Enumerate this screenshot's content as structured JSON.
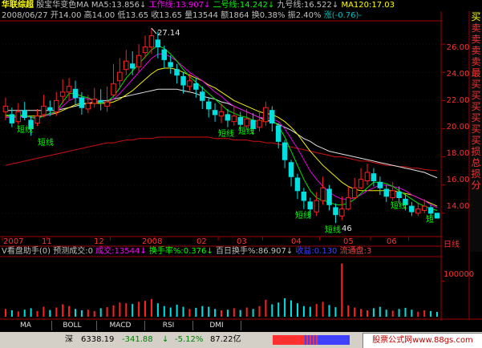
{
  "header": {
    "stock_name": "华联综超",
    "indicator_name": "殷宝华变色MA",
    "ma5": "MA5:13.856",
    "ma5_arrow": "↓",
    "work_line": "工作线:13.907",
    "work_arrow": "↓",
    "line2": "二号线:14.242",
    "line2_arrow": "↓",
    "line9": "九号线:16.522",
    "line9_arrow": "↓",
    "ma120": "MA120:17.03",
    "date": "2008/06/27",
    "open": "开14.00",
    "high": "高14.00",
    "low": "低13.65",
    "close": "收13.65",
    "volume": "量13544",
    "amount": "额1864",
    "turnover": "换0.38%",
    "amplitude": "振2.40%",
    "change": "涨(-0.76)-"
  },
  "indicator_header": {
    "title": "V看盘助手(0)",
    "predict": "预测成交:0",
    "volume": "成交:13544",
    "vol_arrow": "↓",
    "turnover_rate": "换手率%:0.376",
    "turnover_arrow": "↓",
    "hundred_day": "百日换手%:86.907",
    "hundred_arrow": "↓",
    "profit": "收益:0.130",
    "float_shares": "流通盘:3"
  },
  "side_panel": {
    "chars": [
      "买",
      "卖",
      "卖",
      "卖",
      "卖",
      "最",
      "买",
      "买",
      "买",
      "买",
      "买",
      "买",
      "损",
      "总",
      "损",
      "分"
    ]
  },
  "tabs": [
    "MA",
    "BOLL",
    "MACD",
    "RSI",
    "DMI"
  ],
  "status_bar": {
    "market": "深",
    "index": "6338.19",
    "change": "-341.88",
    "down": "↓",
    "percent": "-5.12%",
    "amount": "87.22亿",
    "watermark": "股票公式网www.88gs.com"
  },
  "annotations": {
    "peak_label": "27.14",
    "low_label": "46",
    "short_labels": [
      "短线",
      "短线",
      "短线",
      "短线",
      "短线",
      "短线",
      "短线",
      "短线",
      "短"
    ],
    "period_label": "日线"
  },
  "chart_data": [
    {
      "type": "line",
      "title": "殷宝华变色MA",
      "series_names": [
        "MA5",
        "工作线",
        "二号线",
        "九号线",
        "MA120"
      ],
      "ylim": [
        12.4,
        27.6
      ],
      "y_ticks": [
        14.0,
        16.0,
        18.0,
        20.0,
        22.0,
        24.0,
        26.0
      ],
      "x_ticks": [
        "2007",
        "11",
        "12",
        "2008",
        "02",
        "03",
        "04",
        "05",
        "06"
      ],
      "annotated_peak": 27.14,
      "candles": [
        [
          21.2,
          21.6,
          22.2,
          20.6
        ],
        [
          21.0,
          20.4,
          21.5,
          20.1
        ],
        [
          20.5,
          21.2,
          21.8,
          20.3
        ],
        [
          21.3,
          20.8,
          21.9,
          20.6
        ],
        [
          20.6,
          20.0,
          20.9,
          19.5
        ],
        [
          20.4,
          20.9,
          21.4,
          20.2
        ],
        [
          21.0,
          21.6,
          22.4,
          20.8
        ],
        [
          21.5,
          21.3,
          22.0,
          20.9
        ],
        [
          21.2,
          22.0,
          22.6,
          20.9
        ],
        [
          22.3,
          22.6,
          23.5,
          21.8
        ],
        [
          22.6,
          23.0,
          23.6,
          22.0
        ],
        [
          22.8,
          22.2,
          23.4,
          21.7
        ],
        [
          22.2,
          21.5,
          22.6,
          21.0
        ],
        [
          21.4,
          21.8,
          22.4,
          21.1
        ],
        [
          21.8,
          22.1,
          22.9,
          21.5
        ],
        [
          22.0,
          21.9,
          22.8,
          21.3
        ],
        [
          21.6,
          21.9,
          23.0,
          21.2
        ],
        [
          22.4,
          23.2,
          24.6,
          22.2
        ],
        [
          23.4,
          24.0,
          25.0,
          22.8
        ],
        [
          24.2,
          24.8,
          25.6,
          23.8
        ],
        [
          24.6,
          24.3,
          25.5,
          23.8
        ],
        [
          24.4,
          25.2,
          26.0,
          24.0
        ],
        [
          25.4,
          25.8,
          26.6,
          25.0
        ],
        [
          25.8,
          26.6,
          27.14,
          25.3
        ],
        [
          26.3,
          25.8,
          26.9,
          25.0
        ],
        [
          25.6,
          24.9,
          25.9,
          24.3
        ],
        [
          24.7,
          24.4,
          25.2,
          23.9
        ],
        [
          24.2,
          23.8,
          24.6,
          23.2
        ],
        [
          23.7,
          23.1,
          24.0,
          22.5
        ],
        [
          23.0,
          23.4,
          23.9,
          22.7
        ],
        [
          23.2,
          22.8,
          23.6,
          22.2
        ],
        [
          22.6,
          22.0,
          23.0,
          21.4
        ],
        [
          21.9,
          21.4,
          22.2,
          20.8
        ],
        [
          21.3,
          21.0,
          21.8,
          20.5
        ],
        [
          20.9,
          21.2,
          21.8,
          20.4
        ],
        [
          21.0,
          20.6,
          21.4,
          20.1
        ],
        [
          20.5,
          20.9,
          21.6,
          20.2
        ],
        [
          20.8,
          20.3,
          21.2,
          19.9
        ],
        [
          20.2,
          20.7,
          21.4,
          19.9
        ],
        [
          20.6,
          20.0,
          21.1,
          19.6
        ],
        [
          20.1,
          20.6,
          21.3,
          19.8
        ],
        [
          20.5,
          21.5,
          21.9,
          20.2
        ],
        [
          21.3,
          20.4,
          21.6,
          19.8
        ],
        [
          20.2,
          19.1,
          20.4,
          18.6
        ],
        [
          19.0,
          17.8,
          19.2,
          17.2
        ],
        [
          17.6,
          16.6,
          17.8,
          15.9
        ],
        [
          16.5,
          15.6,
          16.8,
          15.0
        ],
        [
          15.5,
          14.9,
          15.8,
          14.3
        ],
        [
          14.8,
          14.3,
          15.1,
          13.7
        ],
        [
          14.1,
          14.9,
          15.5,
          13.8
        ],
        [
          14.9,
          15.8,
          16.6,
          14.6
        ],
        [
          15.7,
          14.6,
          16.0,
          14.2
        ],
        [
          14.4,
          13.9,
          14.7,
          13.3
        ],
        [
          13.8,
          14.3,
          15.2,
          13.5
        ],
        [
          14.3,
          15.1,
          15.9,
          14.2
        ],
        [
          15.1,
          15.8,
          16.5,
          15.0
        ],
        [
          15.8,
          16.4,
          17.2,
          15.7
        ],
        [
          16.3,
          16.9,
          17.5,
          16.0
        ],
        [
          16.8,
          16.3,
          17.2,
          15.9
        ],
        [
          16.2,
          15.8,
          16.6,
          15.3
        ],
        [
          15.7,
          15.2,
          16.0,
          14.8
        ],
        [
          15.1,
          15.6,
          16.2,
          14.9
        ],
        [
          15.5,
          15.1,
          15.9,
          14.7
        ],
        [
          15.0,
          14.6,
          15.4,
          14.2
        ],
        [
          14.5,
          14.1,
          14.8,
          13.8
        ],
        [
          14.0,
          14.3,
          14.7,
          13.8
        ],
        [
          14.2,
          14.5,
          15.0,
          14.0
        ],
        [
          14.4,
          14.0,
          14.6,
          13.65
        ],
        [
          14.0,
          13.65,
          14.0,
          13.65
        ]
      ],
      "ma5": [
        21.0,
        20.9,
        20.9,
        21.0,
        20.8,
        20.7,
        20.9,
        21.1,
        21.2,
        21.9,
        22.5,
        22.5,
        22.3,
        22.2,
        22.0,
        21.8,
        21.9,
        22.3,
        22.9,
        23.6,
        24.1,
        24.6,
        25.1,
        25.6,
        25.9,
        25.7,
        25.3,
        24.8,
        24.2,
        23.7,
        23.3,
        22.9,
        22.5,
        22.1,
        21.7,
        21.3,
        21.1,
        20.9,
        20.8,
        20.6,
        20.5,
        20.6,
        20.6,
        20.2,
        19.4,
        18.4,
        17.4,
        16.4,
        15.6,
        15.1,
        14.9,
        14.8,
        14.6,
        14.6,
        14.7,
        15.0,
        15.4,
        15.8,
        16.2,
        16.2,
        16.1,
        15.9,
        15.6,
        15.3,
        15.0,
        14.7,
        14.5,
        14.3,
        14.2
      ],
      "work": [
        20.8,
        20.8,
        20.8,
        20.9,
        20.8,
        20.8,
        20.9,
        21.0,
        21.2,
        21.6,
        22.0,
        22.2,
        22.2,
        22.1,
        22.0,
        21.9,
        21.9,
        22.1,
        22.5,
        23.0,
        23.5,
        24.0,
        24.5,
        25.0,
        25.3,
        25.3,
        25.1,
        24.8,
        24.4,
        24.0,
        23.7,
        23.4,
        23.0,
        22.6,
        22.3,
        21.9,
        21.6,
        21.4,
        21.2,
        21.0,
        20.8,
        20.8,
        20.7,
        20.5,
        20.0,
        19.3,
        18.6,
        17.8,
        17.0,
        16.4,
        15.9,
        15.5,
        15.2,
        15.0,
        15.0,
        15.1,
        15.3,
        15.6,
        15.8,
        16.0,
        16.0,
        15.9,
        15.8,
        15.6,
        15.3,
        15.1,
        14.9,
        14.6,
        14.4
      ],
      "line2": [
        20.9,
        20.9,
        20.9,
        20.9,
        20.9,
        20.9,
        20.9,
        21.0,
        21.1,
        21.3,
        21.5,
        21.7,
        21.8,
        21.8,
        21.8,
        21.8,
        21.8,
        21.9,
        22.1,
        22.4,
        22.7,
        23.1,
        23.5,
        23.9,
        24.2,
        24.3,
        24.3,
        24.2,
        24.0,
        23.8,
        23.6,
        23.4,
        23.1,
        22.9,
        22.6,
        22.3,
        22.0,
        21.8,
        21.6,
        21.4,
        21.2,
        21.1,
        21.0,
        20.8,
        20.5,
        20.1,
        19.6,
        19.0,
        18.4,
        17.9,
        17.4,
        17.0,
        16.6,
        16.2,
        15.9,
        15.7,
        15.6,
        15.6,
        15.6,
        15.6,
        15.6,
        15.6,
        15.5,
        15.4,
        15.3,
        15.1,
        14.9,
        14.7,
        14.5
      ],
      "line9": [
        21.3,
        21.3,
        21.3,
        21.3,
        21.3,
        21.3,
        21.3,
        21.3,
        21.3,
        21.4,
        21.5,
        21.6,
        21.7,
        21.8,
        21.9,
        22.0,
        22.0,
        22.1,
        22.2,
        22.3,
        22.4,
        22.5,
        22.6,
        22.7,
        22.8,
        22.8,
        22.8,
        22.8,
        22.7,
        22.6,
        22.5,
        22.3,
        22.2,
        22.1,
        21.9,
        21.8,
        21.6,
        21.4,
        21.2,
        21.0,
        20.8,
        20.6,
        20.5,
        20.3,
        20.1,
        19.9,
        19.6,
        19.3,
        19.1,
        18.8,
        18.6,
        18.4,
        18.3,
        18.2,
        18.1,
        18.0,
        17.9,
        17.8,
        17.7,
        17.6,
        17.5,
        17.4,
        17.3,
        17.2,
        17.1,
        17.0,
        16.9,
        16.7,
        16.52
      ],
      "ma120": [
        17.4,
        17.5,
        17.6,
        17.7,
        17.8,
        17.9,
        18.0,
        18.1,
        18.2,
        18.3,
        18.4,
        18.5,
        18.6,
        18.7,
        18.8,
        18.9,
        19.0,
        19.0,
        19.1,
        19.2,
        19.2,
        19.3,
        19.3,
        19.3,
        19.4,
        19.4,
        19.4,
        19.4,
        19.4,
        19.4,
        19.4,
        19.4,
        19.4,
        19.3,
        19.3,
        19.3,
        19.2,
        19.2,
        19.2,
        19.1,
        19.1,
        19.0,
        19.0,
        18.9,
        18.8,
        18.7,
        18.6,
        18.5,
        18.4,
        18.3,
        18.2,
        18.1,
        18.0,
        18.0,
        17.9,
        17.8,
        17.7,
        17.7,
        17.6,
        17.5,
        17.4,
        17.4,
        17.3,
        17.3,
        17.2,
        17.2,
        17.1,
        17.05,
        17.03
      ]
    },
    {
      "type": "bar",
      "title": "V看盘助手(0)",
      "ylim": [
        0,
        165000
      ],
      "y_ticks": [
        100000
      ],
      "volume": [
        22000,
        18000,
        15000,
        20000,
        24000,
        16000,
        28000,
        19000,
        26000,
        35000,
        30000,
        22000,
        18000,
        20000,
        16000,
        24000,
        27000,
        32000,
        40000,
        38000,
        36000,
        42000,
        45000,
        50000,
        38000,
        30000,
        26000,
        34000,
        28000,
        22000,
        25000,
        30000,
        28000,
        22000,
        18000,
        20000,
        24000,
        19000,
        26000,
        22000,
        30000,
        48000,
        35000,
        40000,
        52000,
        46000,
        38000,
        30000,
        28000,
        36000,
        42000,
        33000,
        27000,
        150000,
        32000,
        26000,
        22000,
        18000,
        24000,
        28000,
        20000,
        17000,
        22000,
        25000,
        20000,
        14000,
        18000,
        16000,
        13544
      ],
      "up": [
        1,
        0,
        1,
        0,
        0,
        1,
        1,
        0,
        1,
        1,
        1,
        0,
        0,
        1,
        1,
        0,
        1,
        1,
        1,
        1,
        0,
        1,
        1,
        1,
        0,
        0,
        0,
        0,
        0,
        1,
        0,
        0,
        0,
        0,
        1,
        0,
        1,
        0,
        1,
        0,
        1,
        1,
        0,
        0,
        0,
        0,
        0,
        0,
        0,
        1,
        1,
        0,
        0,
        1,
        1,
        1,
        1,
        1,
        0,
        0,
        0,
        1,
        0,
        0,
        0,
        1,
        1,
        0,
        0
      ]
    }
  ]
}
